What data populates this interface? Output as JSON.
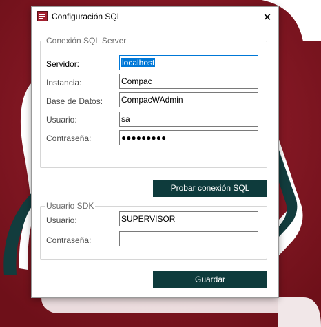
{
  "window": {
    "title": "Configuración SQL",
    "close_glyph": "✕",
    "icon": "database-config-icon"
  },
  "sql_server": {
    "group_title": "Conexión SQL Server",
    "servidor_label": "Servidor:",
    "servidor_value": "localhost",
    "instancia_label": "Instancia:",
    "instancia_value": "Compac",
    "base_datos_label": "Base de Datos:",
    "base_datos_value": "CompacWAdmin",
    "usuario_label": "Usuario:",
    "usuario_value": "sa",
    "contrasena_label": "Contraseña:",
    "contrasena_masked": "●●●●●●●●●",
    "test_button_label": "Probar conexión SQL"
  },
  "sdk": {
    "group_title": "Usuario SDK",
    "usuario_label": "Usuario:",
    "usuario_value": "SUPERVISOR",
    "contrasena_label": "Contraseña:",
    "contrasena_value": ""
  },
  "save_button_label": "Guardar",
  "colors": {
    "background": "#8a1a26",
    "accent_teal": "#0e3b3c",
    "focus_blue": "#0078d7"
  }
}
